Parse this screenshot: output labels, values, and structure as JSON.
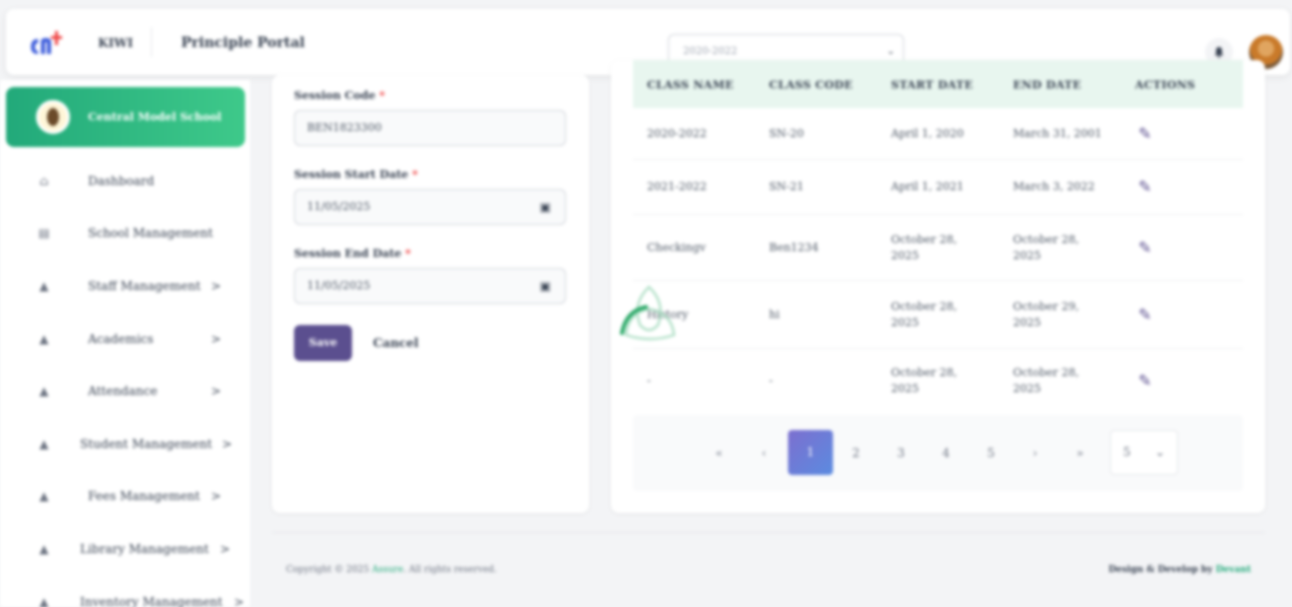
{
  "header": {
    "brand": "KIWI",
    "portal_title": "Principle Portal",
    "session_select_value": "2020-2022"
  },
  "sidebar": {
    "school_name": "Central Model School",
    "items": [
      {
        "label": "Dashboard",
        "icon": "home-icon",
        "chevron": ""
      },
      {
        "label": "School Management",
        "icon": "building-icon",
        "chevron": ""
      },
      {
        "label": "Staff Management",
        "icon": "cap-icon",
        "chevron": ">"
      },
      {
        "label": "Academics",
        "icon": "cap-icon",
        "chevron": ">"
      },
      {
        "label": "Attendance",
        "icon": "cap-icon",
        "chevron": ">"
      },
      {
        "label": "Student Management",
        "icon": "cap-icon",
        "chevron": ">"
      },
      {
        "label": "Fees Management",
        "icon": "cap-icon",
        "chevron": ">"
      },
      {
        "label": "Library Management",
        "icon": "cap-icon",
        "chevron": ">"
      },
      {
        "label": "Inventory Management",
        "icon": "cap-icon",
        "chevron": ">"
      }
    ]
  },
  "form": {
    "session_code_label": "Session Code",
    "session_code_value": "BEN1823300",
    "start_date_label": "Session Start Date",
    "start_date_value": "11/05/2025",
    "end_date_label": "Session End Date",
    "end_date_value": "11/05/2025",
    "required_mark": "*",
    "save_label": "Save",
    "cancel_label": "Cancel"
  },
  "table": {
    "columns": [
      "CLASS NAME",
      "CLASS CODE",
      "START DATE",
      "END DATE",
      "ACTIONS"
    ],
    "rows": [
      [
        "2020-2022",
        "SN-20",
        "April 1, 2020",
        "March 31, 2001"
      ],
      [
        "2021-2022",
        "SN-21",
        "April 1, 2021",
        "March 3, 2022"
      ],
      [
        "Checkingv",
        "Ben1234",
        "October 28, 2025",
        "October 28, 2025"
      ],
      [
        "History",
        "hi",
        "October 28, 2025",
        "October 29, 2025"
      ],
      [
        "-",
        "-",
        "October 28, 2025",
        "October 28, 2025"
      ]
    ],
    "pagination": {
      "first": "«",
      "prev": "‹",
      "pages": [
        "1",
        "2",
        "3",
        "4",
        "5"
      ],
      "active_page": "1",
      "next": "›",
      "last": "»",
      "page_size": "5"
    }
  },
  "footer": {
    "copyright_prefix": "Copyright © 2025",
    "copyright_brand": "Assure",
    "copyright_suffix": "All rights reserved.",
    "design_prefix": "Design & Develop by",
    "design_brand": "Devant"
  },
  "colors": {
    "accent_green": "#22a97a",
    "accent_purple": "#5b4f8f",
    "table_header_bg": "#e8f6ef"
  }
}
